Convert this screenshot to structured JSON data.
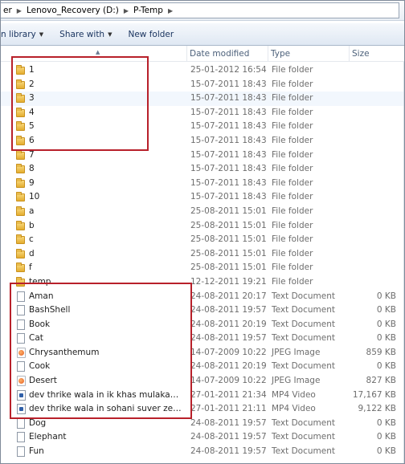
{
  "address": {
    "crumbs": [
      "er",
      "Lenovo_Recovery (D:)",
      "P-Temp"
    ]
  },
  "toolbar": {
    "library_label": "n library",
    "share_label": "Share with",
    "new_folder_label": "New folder"
  },
  "header": {
    "name": "",
    "date": "Date modified",
    "type": "Type",
    "size": "Size"
  },
  "files": [
    {
      "name": "1",
      "date": "25-01-2012 16:54",
      "type": "File folder",
      "size": "",
      "icon": "folder-icon"
    },
    {
      "name": "2",
      "date": "15-07-2011 18:43",
      "type": "File folder",
      "size": "",
      "icon": "folder-icon"
    },
    {
      "name": "3",
      "date": "15-07-2011 18:43",
      "type": "File folder",
      "size": "",
      "icon": "folder-icon"
    },
    {
      "name": "4",
      "date": "15-07-2011 18:43",
      "type": "File folder",
      "size": "",
      "icon": "folder-icon"
    },
    {
      "name": "5",
      "date": "15-07-2011 18:43",
      "type": "File folder",
      "size": "",
      "icon": "folder-icon"
    },
    {
      "name": "6",
      "date": "15-07-2011 18:43",
      "type": "File folder",
      "size": "",
      "icon": "folder-icon"
    },
    {
      "name": "7",
      "date": "15-07-2011 18:43",
      "type": "File folder",
      "size": "",
      "icon": "folder-icon"
    },
    {
      "name": "8",
      "date": "15-07-2011 18:43",
      "type": "File folder",
      "size": "",
      "icon": "folder-icon"
    },
    {
      "name": "9",
      "date": "15-07-2011 18:43",
      "type": "File folder",
      "size": "",
      "icon": "folder-icon"
    },
    {
      "name": "10",
      "date": "15-07-2011 18:43",
      "type": "File folder",
      "size": "",
      "icon": "folder-icon"
    },
    {
      "name": "a",
      "date": "25-08-2011 15:01",
      "type": "File folder",
      "size": "",
      "icon": "folder-icon"
    },
    {
      "name": "b",
      "date": "25-08-2011 15:01",
      "type": "File folder",
      "size": "",
      "icon": "folder-icon"
    },
    {
      "name": "c",
      "date": "25-08-2011 15:01",
      "type": "File folder",
      "size": "",
      "icon": "folder-icon"
    },
    {
      "name": "d",
      "date": "25-08-2011 15:01",
      "type": "File folder",
      "size": "",
      "icon": "folder-icon"
    },
    {
      "name": "f",
      "date": "25-08-2011 15:01",
      "type": "File folder",
      "size": "",
      "icon": "folder-icon"
    },
    {
      "name": "temp",
      "date": "12-12-2011 19:21",
      "type": "File folder",
      "size": "",
      "icon": "folder-icon"
    },
    {
      "name": "Aman",
      "date": "24-08-2011 20:17",
      "type": "Text Document",
      "size": "0 KB",
      "icon": "text-document-icon"
    },
    {
      "name": "BashShell",
      "date": "24-08-2011 19:57",
      "type": "Text Document",
      "size": "0 KB",
      "icon": "text-document-icon"
    },
    {
      "name": "Book",
      "date": "24-08-2011 20:19",
      "type": "Text Document",
      "size": "0 KB",
      "icon": "text-document-icon"
    },
    {
      "name": "Cat",
      "date": "24-08-2011 19:57",
      "type": "Text Document",
      "size": "0 KB",
      "icon": "text-document-icon"
    },
    {
      "name": "Chrysanthemum",
      "date": "14-07-2009 10:22",
      "type": "JPEG Image",
      "size": "859 KB",
      "icon": "jpeg-image-icon"
    },
    {
      "name": "Cook",
      "date": "24-08-2011 20:19",
      "type": "Text Document",
      "size": "0 KB",
      "icon": "text-document-icon"
    },
    {
      "name": "Desert",
      "date": "14-07-2009 10:22",
      "type": "JPEG Image",
      "size": "827 KB",
      "icon": "jpeg-image-icon"
    },
    {
      "name": "dev thrike wala in ik khas mulakat (zee p...",
      "date": "27-01-2011 21:34",
      "type": "MP4 Video",
      "size": "17,167 KB",
      "icon": "mp4-video-icon"
    },
    {
      "name": "dev thrike wala in sohani suver zee punja...",
      "date": "27-01-2011 21:11",
      "type": "MP4 Video",
      "size": "9,122 KB",
      "icon": "mp4-video-icon"
    },
    {
      "name": "Dog",
      "date": "24-08-2011 19:57",
      "type": "Text Document",
      "size": "0 KB",
      "icon": "text-document-icon"
    },
    {
      "name": "Elephant",
      "date": "24-08-2011 19:57",
      "type": "Text Document",
      "size": "0 KB",
      "icon": "text-document-icon"
    },
    {
      "name": "Fun",
      "date": "24-08-2011 19:57",
      "type": "Text Document",
      "size": "0 KB",
      "icon": "text-document-icon"
    }
  ],
  "highlight_color": "#b8202a"
}
